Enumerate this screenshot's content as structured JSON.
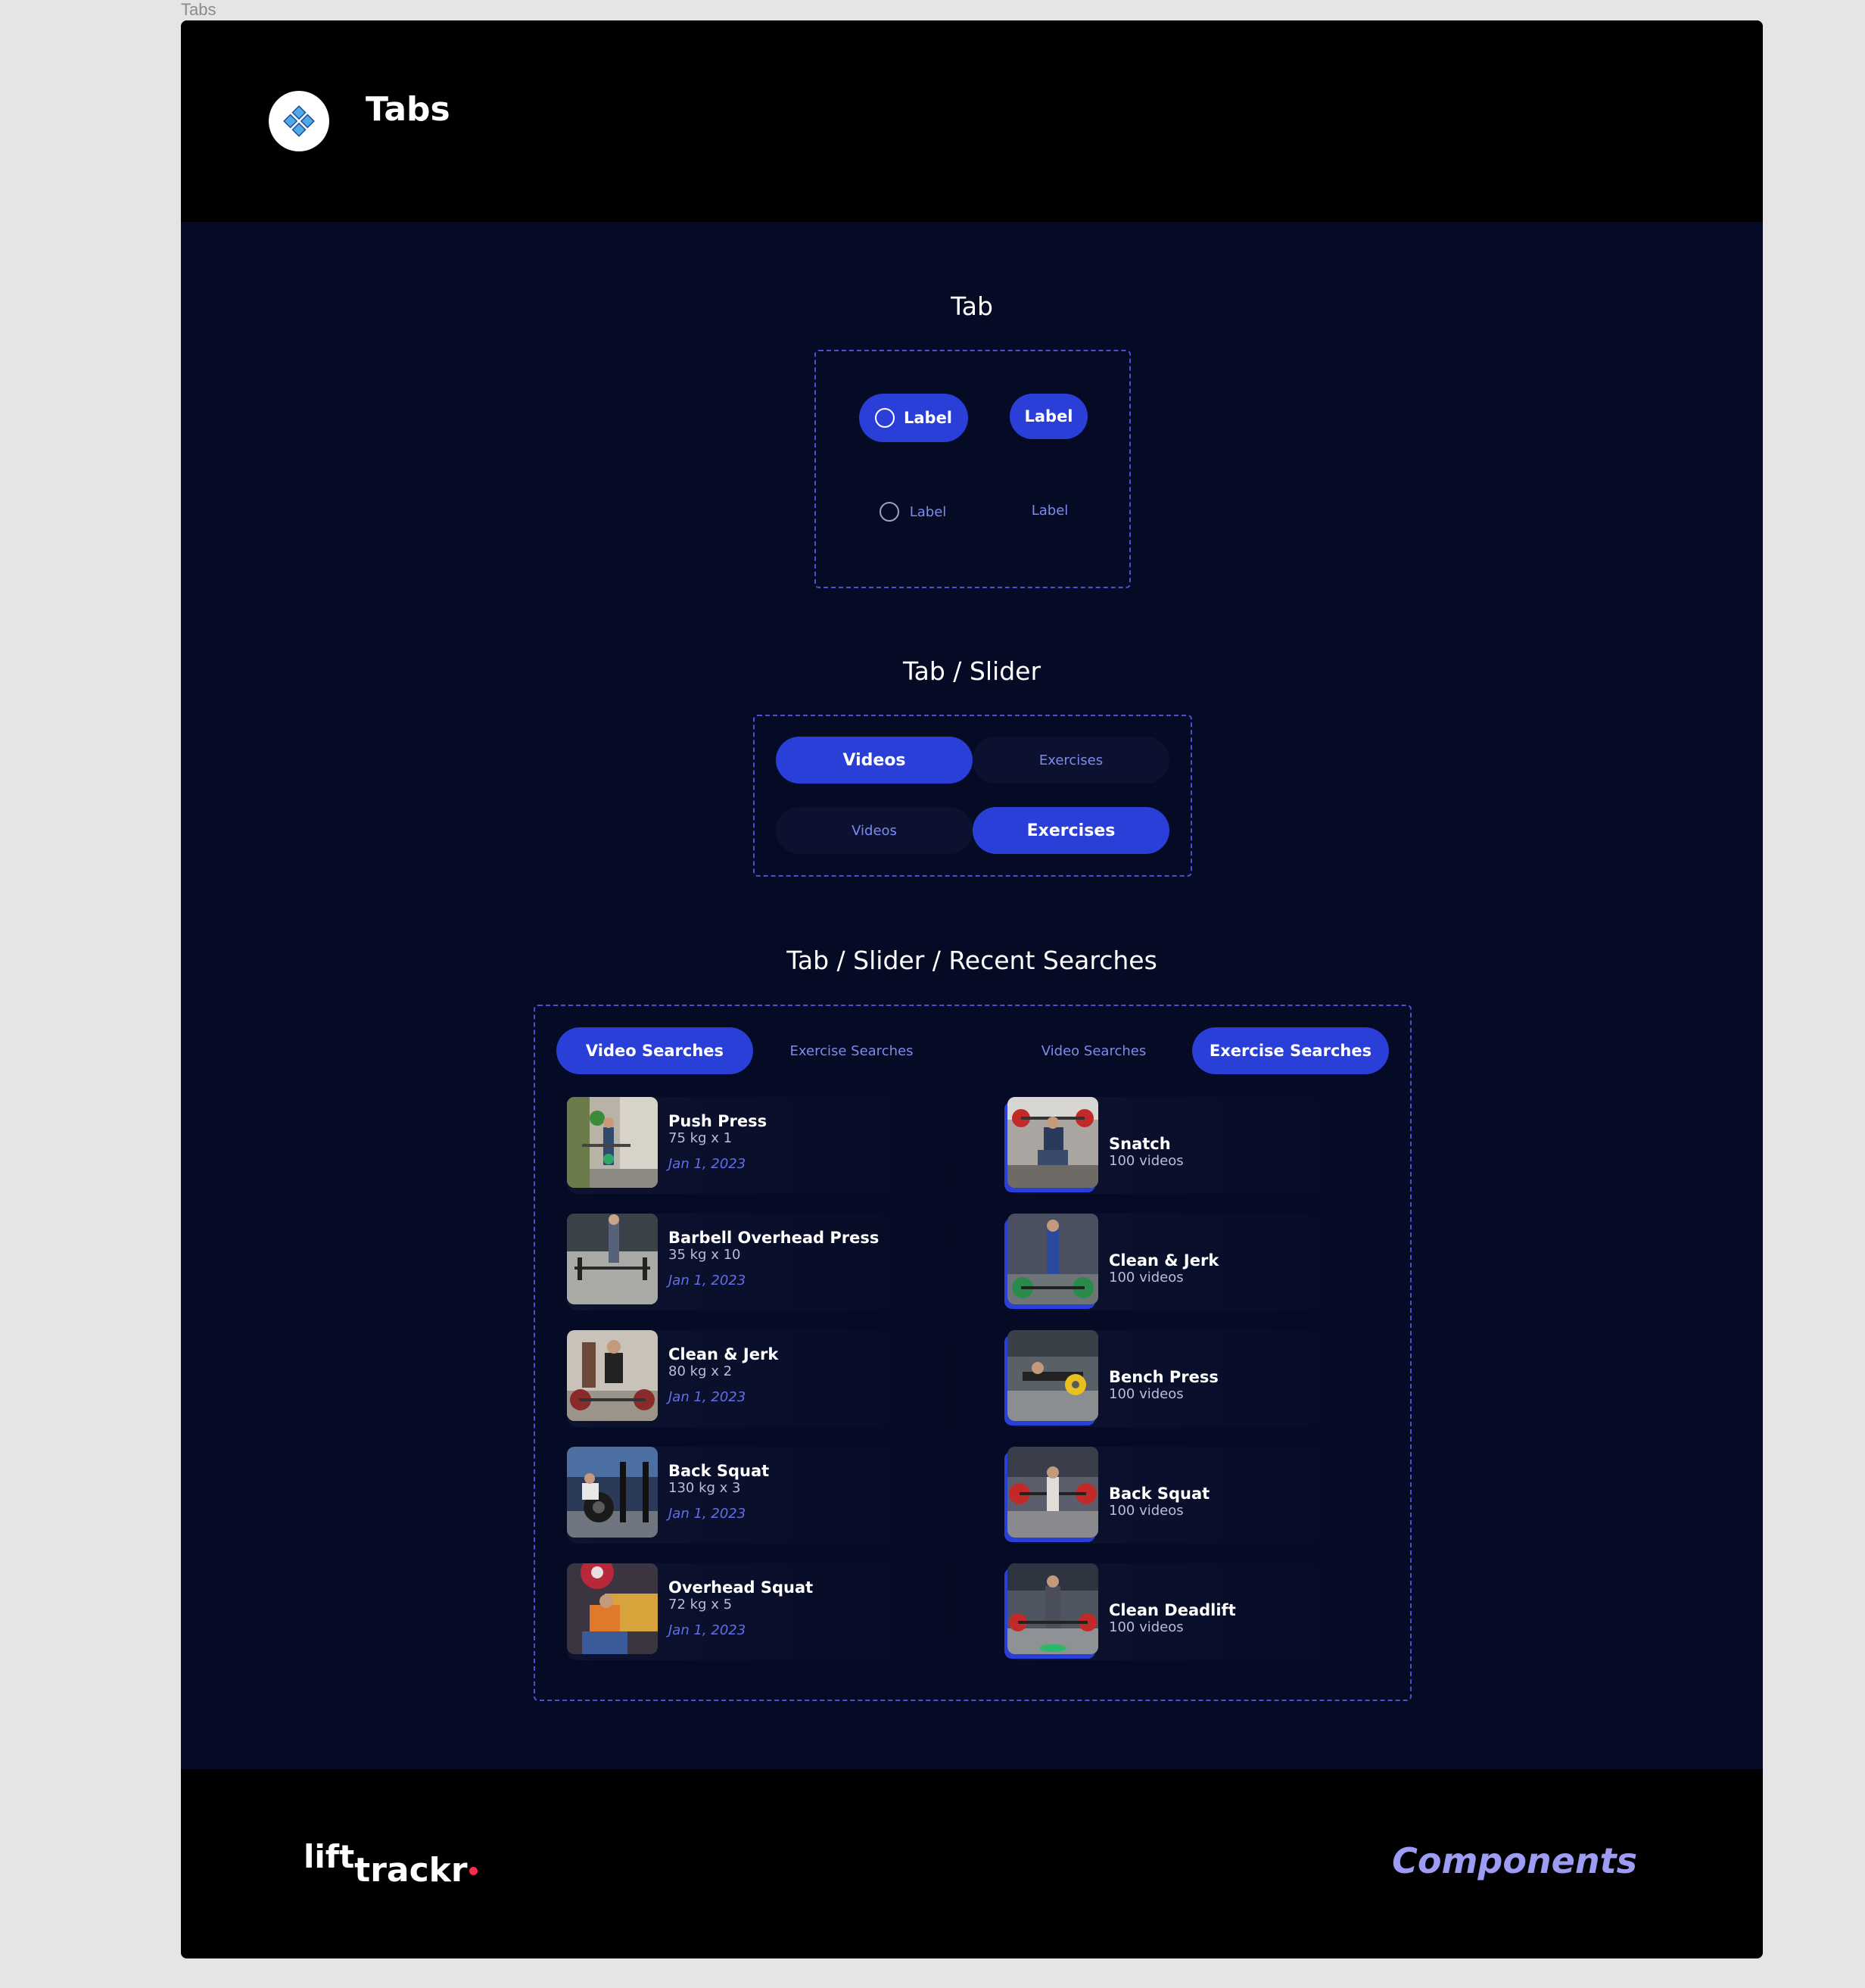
{
  "frame_label": "Tabs",
  "header": {
    "title": "Tabs"
  },
  "sections": {
    "tab": {
      "title": "Tab",
      "active_icon_label": "Label",
      "active_label": "Label",
      "inactive_icon_label": "Label",
      "inactive_label": "Label"
    },
    "slider": {
      "title": "Tab / Slider",
      "row1": {
        "active": "Videos",
        "inactive": "Exercises"
      },
      "row2": {
        "inactive": "Videos",
        "active": "Exercises"
      }
    },
    "recent": {
      "title": "Tab / Slider / Recent Searches",
      "left_tabs": {
        "active": "Video Searches",
        "inactive": "Exercise Searches"
      },
      "right_tabs": {
        "inactive": "Video Searches",
        "active": "Exercise Searches"
      },
      "video_searches": [
        {
          "name": "Push Press",
          "detail": "75 kg x 1",
          "date": "Jan 1, 2023"
        },
        {
          "name": "Barbell Overhead Press",
          "detail": "35 kg x 10",
          "date": "Jan 1, 2023"
        },
        {
          "name": "Clean & Jerk",
          "detail": "80 kg x 2",
          "date": "Jan 1, 2023"
        },
        {
          "name": "Back Squat",
          "detail": "130 kg x 3",
          "date": "Jan 1, 2023"
        },
        {
          "name": "Overhead Squat",
          "detail": "72 kg x 5",
          "date": "Jan 1, 2023"
        }
      ],
      "exercise_searches": [
        {
          "name": "Snatch",
          "detail": "100 videos"
        },
        {
          "name": "Clean & Jerk",
          "detail": "100 videos"
        },
        {
          "name": "Bench Press",
          "detail": "100 videos"
        },
        {
          "name": "Back Squat",
          "detail": "100 videos"
        },
        {
          "name": "Clean Deadlift",
          "detail": "100 videos"
        }
      ]
    }
  },
  "footer": {
    "brand_lift": "lift",
    "brand_trackr": "trackr",
    "components": "Components"
  },
  "colors": {
    "accent": "#2a3fd8",
    "background": "#050b24",
    "header_bg": "#000000",
    "dashed_border": "#4a4fd6",
    "inactive_text": "#7d8bf0",
    "brand_dot": "#ff2b4f",
    "components_text": "#9d9cf5"
  }
}
